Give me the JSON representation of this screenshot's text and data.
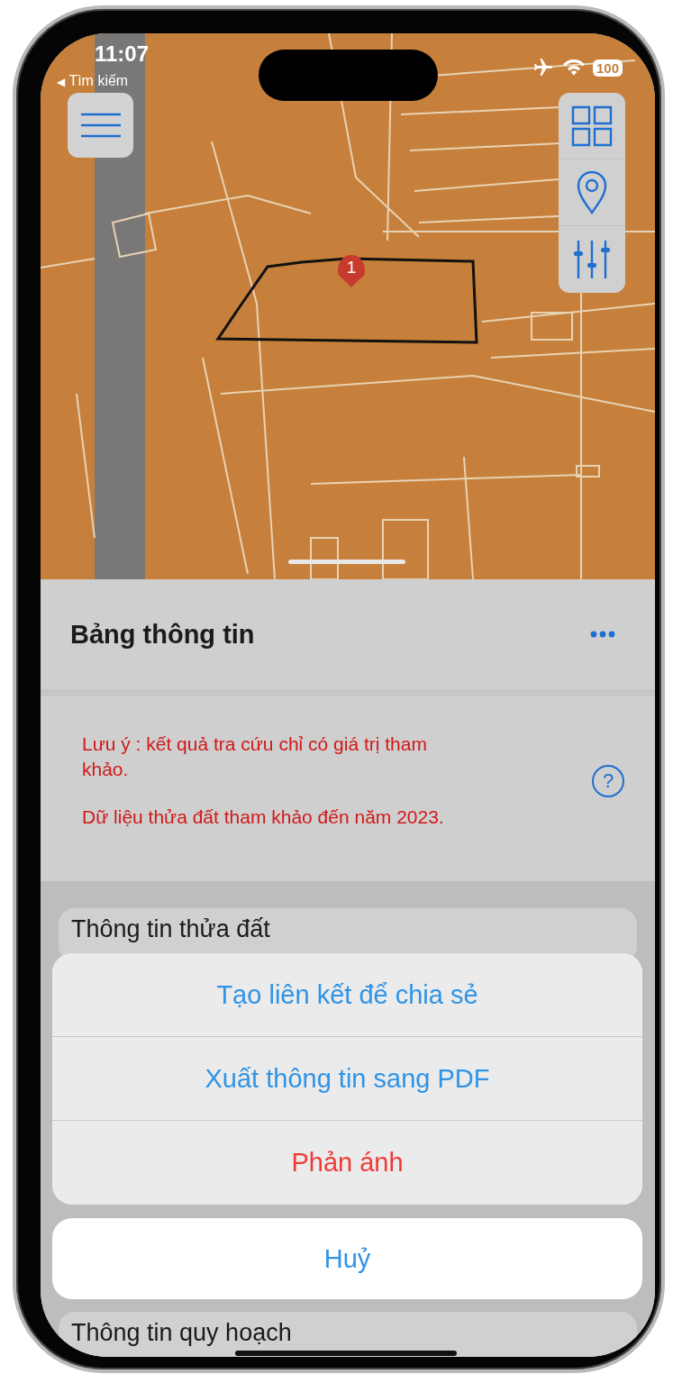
{
  "status_bar": {
    "time": "11:07",
    "back_arrow": "◀",
    "back_label": "Tìm kiếm",
    "battery": "100"
  },
  "map": {
    "marker_label": "1"
  },
  "panel": {
    "title": "Bảng thông tin",
    "help": "?",
    "notes": [
      "Lưu ý : kết quả tra cứu chỉ có giá trị tham khảo.",
      "Dữ liệu thửa đất tham khảo đến năm 2023."
    ]
  },
  "sections": [
    {
      "title": "Thông tin thửa đất"
    },
    {
      "title": "Thông tin quy hoạch"
    }
  ],
  "action_sheet": {
    "actions": [
      {
        "label": "Tạo liên kết để chia sẻ",
        "kind": "default"
      },
      {
        "label": "Xuất thông tin sang PDF",
        "kind": "default"
      },
      {
        "label": "Phản ánh",
        "kind": "destructive"
      }
    ],
    "cancel": "Huỷ"
  }
}
